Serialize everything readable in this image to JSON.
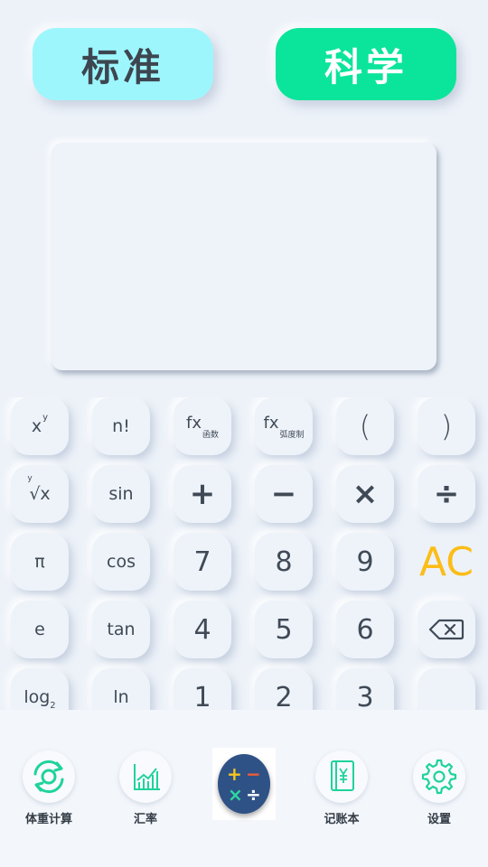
{
  "mode_tabs": {
    "standard": "标准",
    "scientific": "科学"
  },
  "display": {
    "expression": "",
    "result": ""
  },
  "keys": {
    "pow_base": "x",
    "pow_exp": "y",
    "factorial": "n!",
    "fx_func_main": "fx",
    "fx_func_sub": "函数",
    "fx_rad_main": "fx",
    "fx_rad_sub": "弧度制",
    "lparen": "(",
    "rparen": ")",
    "root_index": "y",
    "root_body": "√x",
    "sin": "sin",
    "plus": "+",
    "minus": "−",
    "multiply": "×",
    "divide": "÷",
    "pi": "π",
    "cos": "cos",
    "n7": "7",
    "n8": "8",
    "n9": "9",
    "clear": "AC",
    "e": "e",
    "tan": "tan",
    "n4": "4",
    "n5": "5",
    "n6": "6",
    "log_main": "log",
    "log_sub": "2",
    "ln": "ln",
    "n1": "1",
    "n2": "2",
    "n3": "3"
  },
  "bottom_nav": {
    "items": [
      {
        "label": "体重计算",
        "icon": "weight-refresh-icon"
      },
      {
        "label": "汇率",
        "icon": "exchange-chart-icon"
      },
      {
        "label": "",
        "icon": "calculator-operators-icon"
      },
      {
        "label": "记账本",
        "icon": "ledger-yen-icon"
      },
      {
        "label": "设置",
        "icon": "gear-icon"
      }
    ]
  },
  "calculator_icon_glyphs": {
    "plus": "+",
    "minus": "−",
    "times": "×",
    "divide": "÷"
  },
  "colors": {
    "background": "#edf2f9",
    "standard_tab": "#9ef6fd",
    "scientific_tab": "#0be59b",
    "clear_key": "#fbbd18",
    "accent_green": "#1fd39a",
    "center_icon": "#2f5286"
  }
}
